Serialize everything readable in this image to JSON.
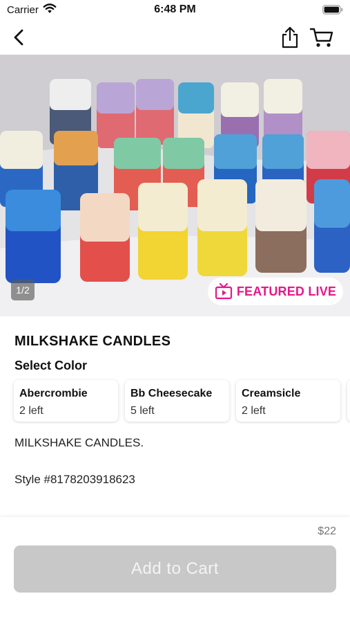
{
  "status_bar": {
    "carrier": "Carrier",
    "time": "6:48 PM"
  },
  "nav": {
    "back_icon": "chevron-left-icon",
    "share_icon": "share-icon",
    "cart_icon": "cart-icon"
  },
  "hero": {
    "page_indicator": "1/2",
    "badge_icon": "tv-play-icon",
    "badge_label": "FEATURED LIVE",
    "badge_color": "#e6178a"
  },
  "product": {
    "title": "MILKSHAKE CANDLES",
    "select_color_label": "Select Color",
    "colors": [
      {
        "name": "Abercrombie",
        "stock": "2 left"
      },
      {
        "name": "Bb Cheesecake",
        "stock": "5 left"
      },
      {
        "name": "Creamsicle",
        "stock": "2 left"
      },
      {
        "name": "",
        "stock": ""
      }
    ],
    "description": "MILKSHAKE CANDLES.",
    "style": "Style #8178203918623"
  },
  "footer": {
    "price": "$22",
    "add_to_cart_label": "Add to Cart",
    "button_color": "#c8c8c8"
  }
}
